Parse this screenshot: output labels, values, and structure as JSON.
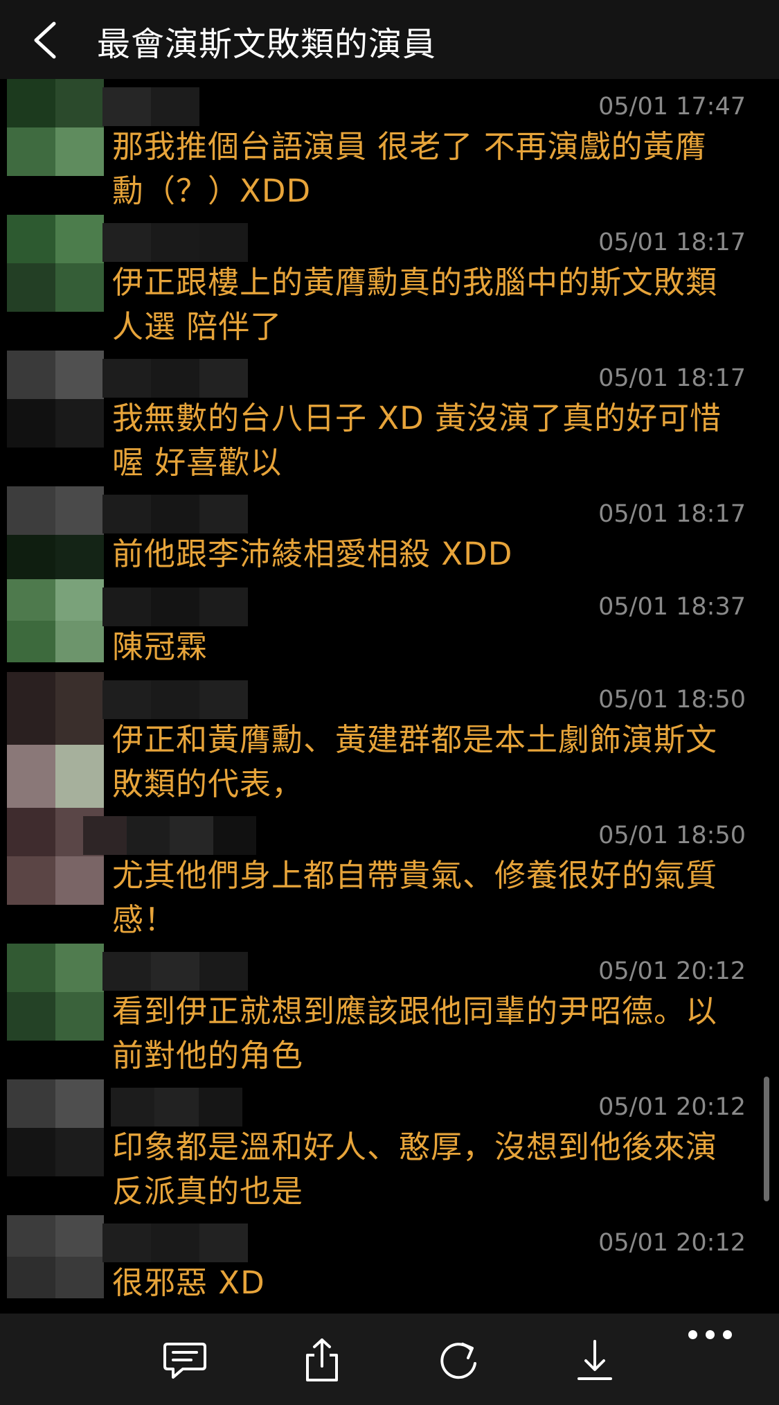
{
  "header": {
    "title": "最會演斯文敗類的演員"
  },
  "comments": [
    {
      "timestamp": "05/01 17:47",
      "text": "那我推個台語演員 很老了 不再演戲的黃膺勳（？）XDD"
    },
    {
      "timestamp": "05/01 18:17",
      "text": "伊正跟樓上的黃膺勳真的我腦中的斯文敗類人選 陪伴了"
    },
    {
      "timestamp": "05/01 18:17",
      "text": "我無數的台八日子 XD 黃沒演了真的好可惜喔 好喜歡以"
    },
    {
      "timestamp": "05/01 18:17",
      "text": "前他跟李沛綾相愛相殺 XDD"
    },
    {
      "timestamp": "05/01 18:37",
      "text": "陳冠霖"
    },
    {
      "timestamp": "05/01 18:50",
      "text": "伊正和黃膺勳、黃建群都是本土劇飾演斯文敗類的代表，"
    },
    {
      "timestamp": "05/01 18:50",
      "text": "尤其他們身上都自帶貴氣、修養很好的氣質感！"
    },
    {
      "timestamp": "05/01 20:12",
      "text": "看到伊正就想到應該跟他同輩的尹昭德。以前對他的角色"
    },
    {
      "timestamp": "05/01 20:12",
      "text": "印象都是溫和好人、憨厚，沒想到他後來演反派真的也是"
    },
    {
      "timestamp": "05/01 20:12",
      "text": "很邪惡 XD"
    }
  ],
  "toolbar": {
    "icons": [
      "comment-icon",
      "share-icon",
      "refresh-icon",
      "download-icon",
      "more-icon"
    ]
  },
  "colors": {
    "accent": "#e7a43a",
    "timestamp": "#8a8a8a",
    "background": "#000000",
    "toolbar": "#1a1a1a"
  }
}
